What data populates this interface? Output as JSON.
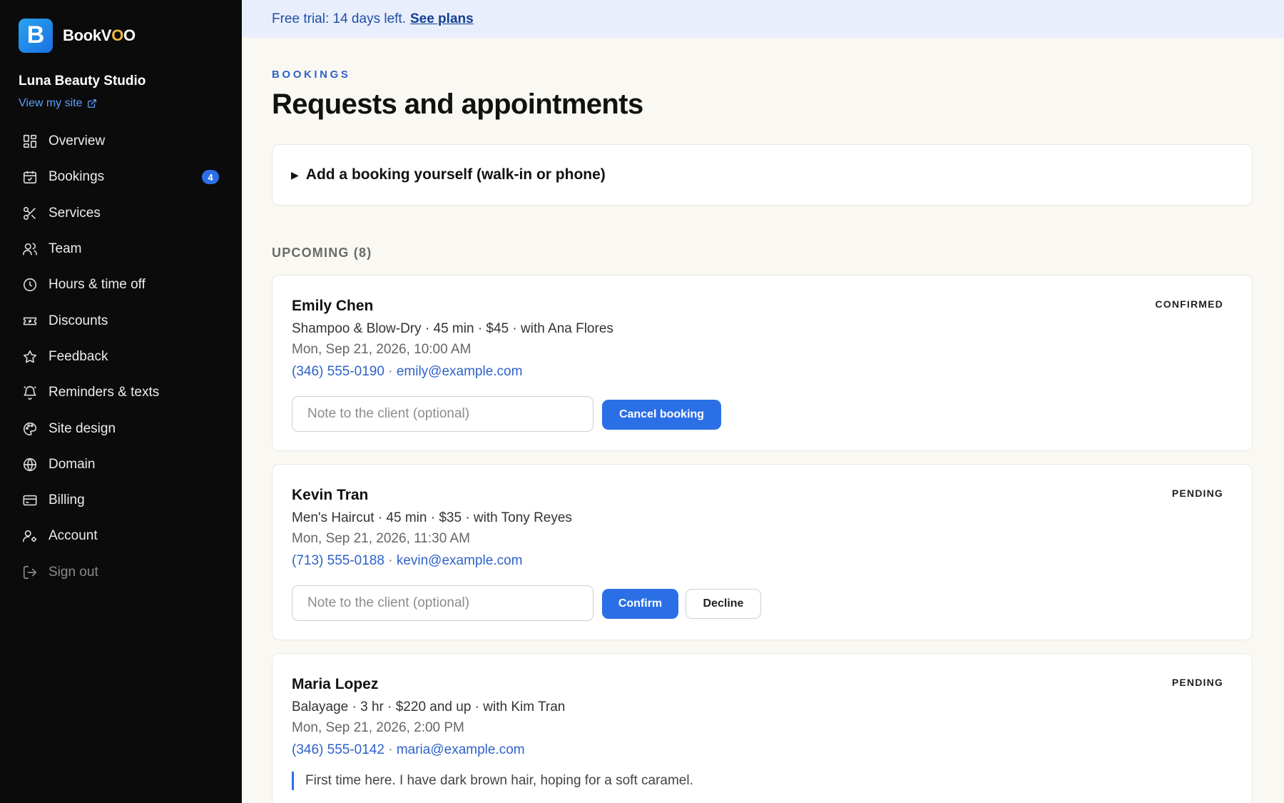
{
  "brand": {
    "name_prefix": "BookV",
    "name_accent": "O",
    "name_suffix": "O",
    "logo_letter": "B"
  },
  "sidebar": {
    "studio": "Luna Beauty Studio",
    "view_site": "View my site",
    "items": [
      {
        "label": "Overview",
        "icon": "grid-icon"
      },
      {
        "label": "Bookings",
        "icon": "calendar-icon",
        "badge": "4"
      },
      {
        "label": "Services",
        "icon": "scissors-icon"
      },
      {
        "label": "Team",
        "icon": "users-icon"
      },
      {
        "label": "Hours & time off",
        "icon": "clock-icon"
      },
      {
        "label": "Discounts",
        "icon": "ticket-icon"
      },
      {
        "label": "Feedback",
        "icon": "star-icon"
      },
      {
        "label": "Reminders & texts",
        "icon": "bell-icon"
      },
      {
        "label": "Site design",
        "icon": "palette-icon"
      },
      {
        "label": "Domain",
        "icon": "globe-icon"
      },
      {
        "label": "Billing",
        "icon": "credit-card-icon"
      },
      {
        "label": "Account",
        "icon": "user-gear-icon"
      },
      {
        "label": "Sign out",
        "icon": "logout-icon"
      }
    ]
  },
  "trial": {
    "text": "Free trial: 14 days left.",
    "link": "See plans"
  },
  "header": {
    "eyebrow": "BOOKINGS",
    "title": "Requests and appointments"
  },
  "add_booking": {
    "label": "Add a booking yourself (walk-in or phone)"
  },
  "upcoming": {
    "heading": "UPCOMING (8)",
    "bookings": [
      {
        "name": "Emily Chen",
        "status": "CONFIRMED",
        "service": "Shampoo & Blow-Dry · 45 min · $45 · with Ana Flores",
        "when": "Mon, Sep 21, 2026, 10:00 AM",
        "phone": "(346) 555-0190",
        "email": "emily@example.com",
        "note_placeholder": "Note to the client (optional)",
        "primary_action": "Cancel booking"
      },
      {
        "name": "Kevin Tran",
        "status": "PENDING",
        "service": "Men's Haircut · 45 min · $35 · with Tony Reyes",
        "when": "Mon, Sep 21, 2026, 11:30 AM",
        "phone": "(713) 555-0188",
        "email": "kevin@example.com",
        "note_placeholder": "Note to the client (optional)",
        "primary_action": "Confirm",
        "secondary_action": "Decline"
      },
      {
        "name": "Maria Lopez",
        "status": "PENDING",
        "service": "Balayage · 3 hr · $220 and up · with Kim Tran",
        "when": "Mon, Sep 21, 2026, 2:00 PM",
        "phone": "(346) 555-0142",
        "email": "maria@example.com",
        "client_note": "First time here. I have dark brown hair, hoping for a soft caramel."
      }
    ]
  },
  "separator": "·",
  "colors": {
    "accent": "#2b6fe6",
    "sidebar_bg": "#0b0b0b",
    "page_bg": "#faf8f3",
    "trial_bg": "#e8eefb"
  }
}
